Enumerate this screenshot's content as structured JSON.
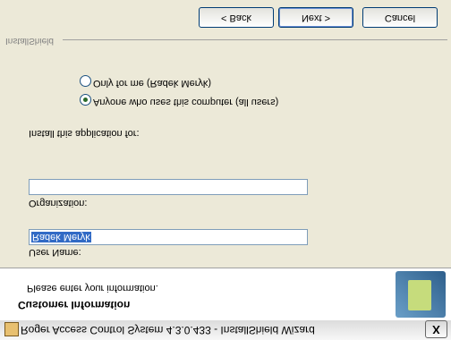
{
  "window": {
    "title": "Roger Access Control System 4.3.0.433 - InstallShield Wizard",
    "close_label": "X"
  },
  "header": {
    "title": "Customer Information",
    "subtitle": "Please enter your information."
  },
  "form": {
    "user_name_label": "User Name:",
    "user_name_value": "Radek Meryk",
    "organization_label": "Organization:",
    "organization_value": "",
    "install_for_label": "Install this application for:",
    "options": [
      {
        "label": "Anyone who uses this computer (all users)",
        "selected": true
      },
      {
        "label": "Only for me (Radek Meryk)",
        "selected": false
      }
    ]
  },
  "footer": {
    "brand": "InstallShield",
    "back_label": "< Back",
    "next_label": "Next >",
    "cancel_label": "Cancel"
  }
}
